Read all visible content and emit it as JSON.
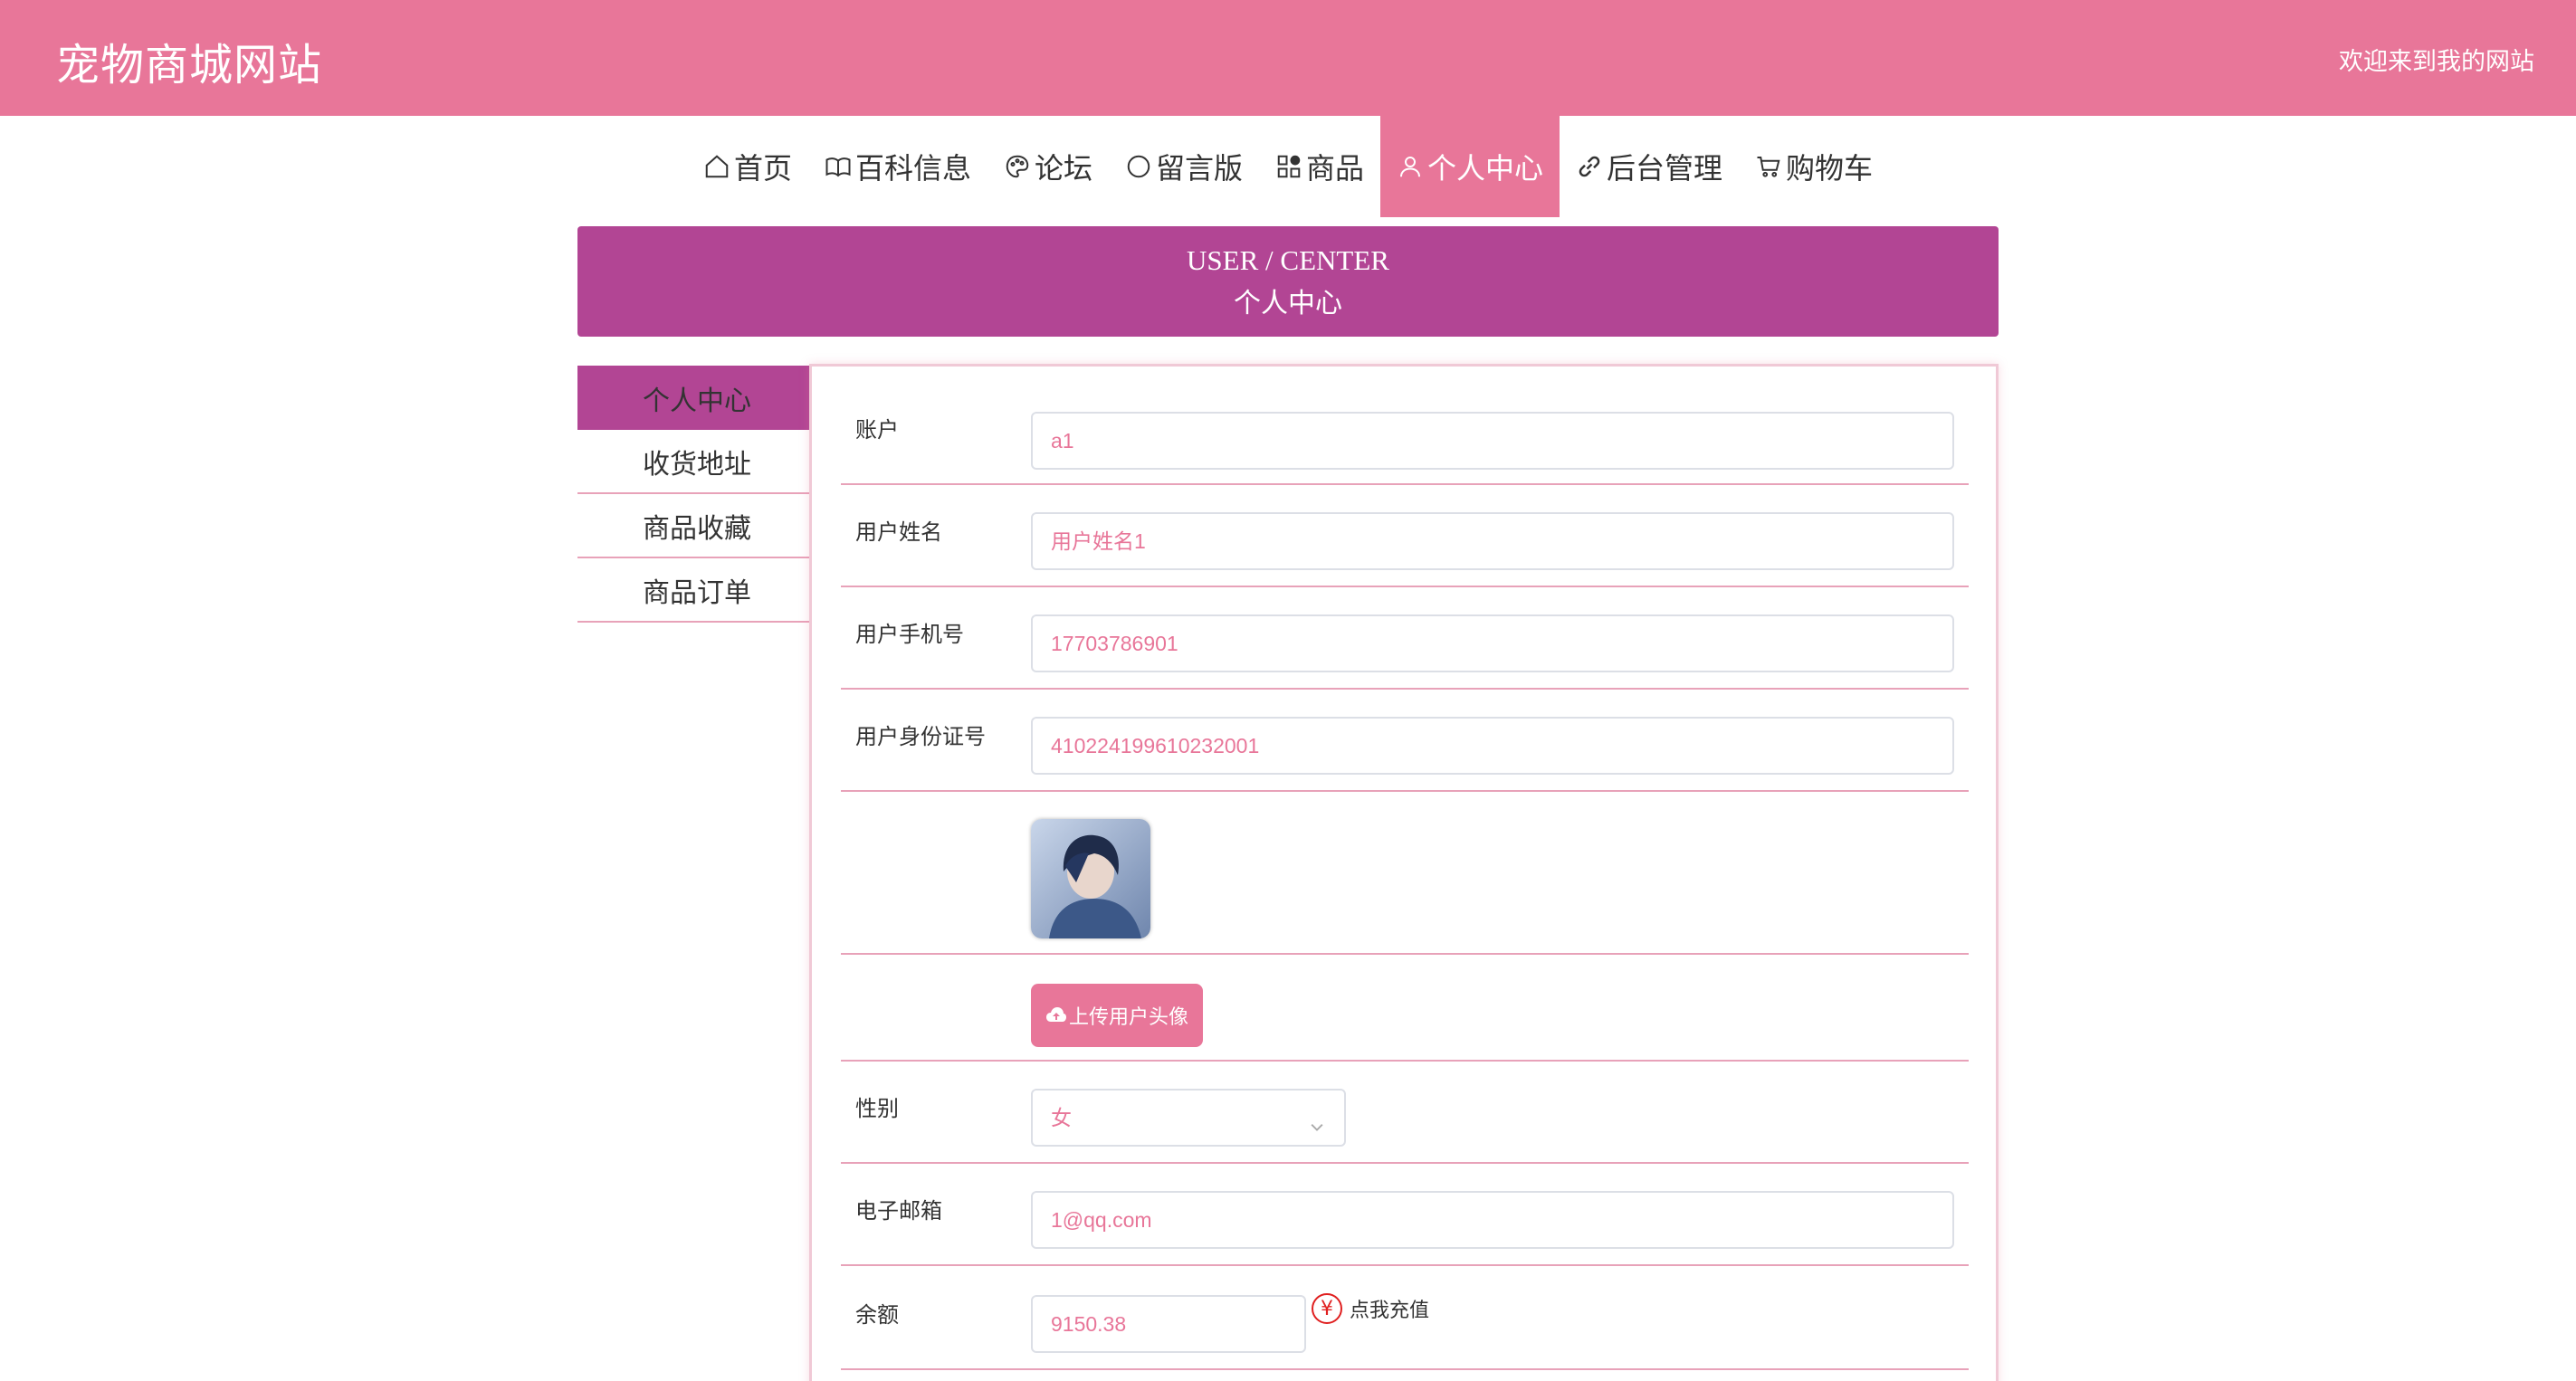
{
  "header": {
    "site_title": "宠物商城网站",
    "welcome": "欢迎来到我的网站"
  },
  "nav": {
    "items": [
      {
        "label": "首页",
        "icon": "home-icon"
      },
      {
        "label": "百科信息",
        "icon": "book-icon"
      },
      {
        "label": "论坛",
        "icon": "palette-icon"
      },
      {
        "label": "留言版",
        "icon": "chat-bubble-icon"
      },
      {
        "label": "商品",
        "icon": "grid-icon"
      },
      {
        "label": "个人中心",
        "icon": "user-icon",
        "active": true
      },
      {
        "label": "后台管理",
        "icon": "link-icon"
      },
      {
        "label": "购物车",
        "icon": "cart-icon"
      }
    ]
  },
  "banner": {
    "en": "USER / CENTER",
    "cn": "个人中心"
  },
  "sidebar": {
    "items": [
      {
        "label": "个人中心",
        "active": true
      },
      {
        "label": "收货地址"
      },
      {
        "label": "商品收藏"
      },
      {
        "label": "商品订单"
      }
    ]
  },
  "form": {
    "account": {
      "label": "账户",
      "value": "a1"
    },
    "name": {
      "label": "用户姓名",
      "value": "用户姓名1"
    },
    "phone": {
      "label": "用户手机号",
      "value": "17703786901"
    },
    "idcard": {
      "label": "用户身份证号",
      "value": "410224199610232001"
    },
    "upload_label": "上传用户头像",
    "gender": {
      "label": "性别",
      "value": "女"
    },
    "email": {
      "label": "电子邮箱",
      "value": "1@qq.com"
    },
    "balance": {
      "label": "余额",
      "value": "9150.38",
      "recharge_label": "点我充值",
      "recharge_icon": "yen-icon"
    }
  },
  "colors": {
    "primary": "#e87699",
    "accent": "#b24594",
    "divider": "#e8a2b9"
  }
}
